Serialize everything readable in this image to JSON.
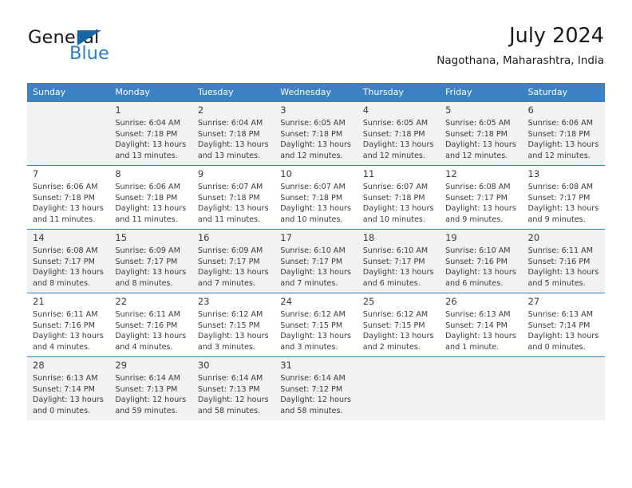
{
  "brand": {
    "name_part1": "General",
    "name_part2": "Blue",
    "flag_color": "#1767a8",
    "blue_color": "#2980c4"
  },
  "header": {
    "title": "July 2024",
    "subtitle": "Nagothana, Maharashtra, India"
  },
  "calendar": {
    "accent_color": "#3b81c4",
    "alt_row_color": "#f2f2f2",
    "weekday_headers": [
      "Sunday",
      "Monday",
      "Tuesday",
      "Wednesday",
      "Thursday",
      "Friday",
      "Saturday"
    ],
    "weeks": [
      {
        "alt": true,
        "days": [
          {
            "num": "",
            "sunrise": "",
            "sunset": "",
            "daylight1": "",
            "daylight2": "",
            "empty": true
          },
          {
            "num": "1",
            "sunrise": "Sunrise: 6:04 AM",
            "sunset": "Sunset: 7:18 PM",
            "daylight1": "Daylight: 13 hours",
            "daylight2": "and 13 minutes."
          },
          {
            "num": "2",
            "sunrise": "Sunrise: 6:04 AM",
            "sunset": "Sunset: 7:18 PM",
            "daylight1": "Daylight: 13 hours",
            "daylight2": "and 13 minutes."
          },
          {
            "num": "3",
            "sunrise": "Sunrise: 6:05 AM",
            "sunset": "Sunset: 7:18 PM",
            "daylight1": "Daylight: 13 hours",
            "daylight2": "and 12 minutes."
          },
          {
            "num": "4",
            "sunrise": "Sunrise: 6:05 AM",
            "sunset": "Sunset: 7:18 PM",
            "daylight1": "Daylight: 13 hours",
            "daylight2": "and 12 minutes."
          },
          {
            "num": "5",
            "sunrise": "Sunrise: 6:05 AM",
            "sunset": "Sunset: 7:18 PM",
            "daylight1": "Daylight: 13 hours",
            "daylight2": "and 12 minutes."
          },
          {
            "num": "6",
            "sunrise": "Sunrise: 6:06 AM",
            "sunset": "Sunset: 7:18 PM",
            "daylight1": "Daylight: 13 hours",
            "daylight2": "and 12 minutes."
          }
        ]
      },
      {
        "alt": false,
        "days": [
          {
            "num": "7",
            "sunrise": "Sunrise: 6:06 AM",
            "sunset": "Sunset: 7:18 PM",
            "daylight1": "Daylight: 13 hours",
            "daylight2": "and 11 minutes."
          },
          {
            "num": "8",
            "sunrise": "Sunrise: 6:06 AM",
            "sunset": "Sunset: 7:18 PM",
            "daylight1": "Daylight: 13 hours",
            "daylight2": "and 11 minutes."
          },
          {
            "num": "9",
            "sunrise": "Sunrise: 6:07 AM",
            "sunset": "Sunset: 7:18 PM",
            "daylight1": "Daylight: 13 hours",
            "daylight2": "and 11 minutes."
          },
          {
            "num": "10",
            "sunrise": "Sunrise: 6:07 AM",
            "sunset": "Sunset: 7:18 PM",
            "daylight1": "Daylight: 13 hours",
            "daylight2": "and 10 minutes."
          },
          {
            "num": "11",
            "sunrise": "Sunrise: 6:07 AM",
            "sunset": "Sunset: 7:18 PM",
            "daylight1": "Daylight: 13 hours",
            "daylight2": "and 10 minutes."
          },
          {
            "num": "12",
            "sunrise": "Sunrise: 6:08 AM",
            "sunset": "Sunset: 7:17 PM",
            "daylight1": "Daylight: 13 hours",
            "daylight2": "and 9 minutes."
          },
          {
            "num": "13",
            "sunrise": "Sunrise: 6:08 AM",
            "sunset": "Sunset: 7:17 PM",
            "daylight1": "Daylight: 13 hours",
            "daylight2": "and 9 minutes."
          }
        ]
      },
      {
        "alt": true,
        "days": [
          {
            "num": "14",
            "sunrise": "Sunrise: 6:08 AM",
            "sunset": "Sunset: 7:17 PM",
            "daylight1": "Daylight: 13 hours",
            "daylight2": "and 8 minutes."
          },
          {
            "num": "15",
            "sunrise": "Sunrise: 6:09 AM",
            "sunset": "Sunset: 7:17 PM",
            "daylight1": "Daylight: 13 hours",
            "daylight2": "and 8 minutes."
          },
          {
            "num": "16",
            "sunrise": "Sunrise: 6:09 AM",
            "sunset": "Sunset: 7:17 PM",
            "daylight1": "Daylight: 13 hours",
            "daylight2": "and 7 minutes."
          },
          {
            "num": "17",
            "sunrise": "Sunrise: 6:10 AM",
            "sunset": "Sunset: 7:17 PM",
            "daylight1": "Daylight: 13 hours",
            "daylight2": "and 7 minutes."
          },
          {
            "num": "18",
            "sunrise": "Sunrise: 6:10 AM",
            "sunset": "Sunset: 7:17 PM",
            "daylight1": "Daylight: 13 hours",
            "daylight2": "and 6 minutes."
          },
          {
            "num": "19",
            "sunrise": "Sunrise: 6:10 AM",
            "sunset": "Sunset: 7:16 PM",
            "daylight1": "Daylight: 13 hours",
            "daylight2": "and 6 minutes."
          },
          {
            "num": "20",
            "sunrise": "Sunrise: 6:11 AM",
            "sunset": "Sunset: 7:16 PM",
            "daylight1": "Daylight: 13 hours",
            "daylight2": "and 5 minutes."
          }
        ]
      },
      {
        "alt": false,
        "days": [
          {
            "num": "21",
            "sunrise": "Sunrise: 6:11 AM",
            "sunset": "Sunset: 7:16 PM",
            "daylight1": "Daylight: 13 hours",
            "daylight2": "and 4 minutes."
          },
          {
            "num": "22",
            "sunrise": "Sunrise: 6:11 AM",
            "sunset": "Sunset: 7:16 PM",
            "daylight1": "Daylight: 13 hours",
            "daylight2": "and 4 minutes."
          },
          {
            "num": "23",
            "sunrise": "Sunrise: 6:12 AM",
            "sunset": "Sunset: 7:15 PM",
            "daylight1": "Daylight: 13 hours",
            "daylight2": "and 3 minutes."
          },
          {
            "num": "24",
            "sunrise": "Sunrise: 6:12 AM",
            "sunset": "Sunset: 7:15 PM",
            "daylight1": "Daylight: 13 hours",
            "daylight2": "and 3 minutes."
          },
          {
            "num": "25",
            "sunrise": "Sunrise: 6:12 AM",
            "sunset": "Sunset: 7:15 PM",
            "daylight1": "Daylight: 13 hours",
            "daylight2": "and 2 minutes."
          },
          {
            "num": "26",
            "sunrise": "Sunrise: 6:13 AM",
            "sunset": "Sunset: 7:14 PM",
            "daylight1": "Daylight: 13 hours",
            "daylight2": "and 1 minute."
          },
          {
            "num": "27",
            "sunrise": "Sunrise: 6:13 AM",
            "sunset": "Sunset: 7:14 PM",
            "daylight1": "Daylight: 13 hours",
            "daylight2": "and 0 minutes."
          }
        ]
      },
      {
        "alt": true,
        "days": [
          {
            "num": "28",
            "sunrise": "Sunrise: 6:13 AM",
            "sunset": "Sunset: 7:14 PM",
            "daylight1": "Daylight: 13 hours",
            "daylight2": "and 0 minutes."
          },
          {
            "num": "29",
            "sunrise": "Sunrise: 6:14 AM",
            "sunset": "Sunset: 7:13 PM",
            "daylight1": "Daylight: 12 hours",
            "daylight2": "and 59 minutes."
          },
          {
            "num": "30",
            "sunrise": "Sunrise: 6:14 AM",
            "sunset": "Sunset: 7:13 PM",
            "daylight1": "Daylight: 12 hours",
            "daylight2": "and 58 minutes."
          },
          {
            "num": "31",
            "sunrise": "Sunrise: 6:14 AM",
            "sunset": "Sunset: 7:12 PM",
            "daylight1": "Daylight: 12 hours",
            "daylight2": "and 58 minutes."
          },
          {
            "num": "",
            "sunrise": "",
            "sunset": "",
            "daylight1": "",
            "daylight2": "",
            "empty": true
          },
          {
            "num": "",
            "sunrise": "",
            "sunset": "",
            "daylight1": "",
            "daylight2": "",
            "empty": true
          },
          {
            "num": "",
            "sunrise": "",
            "sunset": "",
            "daylight1": "",
            "daylight2": "",
            "empty": true
          }
        ]
      }
    ]
  }
}
